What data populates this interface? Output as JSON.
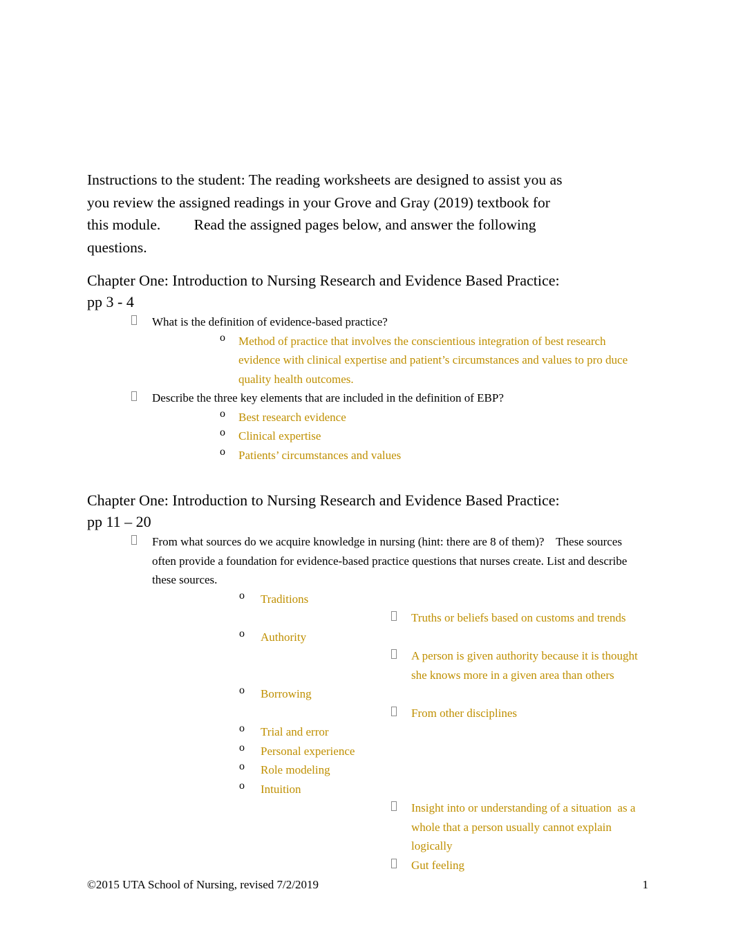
{
  "document": {
    "intro": "Instructions to the student: The reading worksheets are designed to assist you as you review the assigned readings in your Grove and Gray (2019) textbook for this module.         Read the assigned pages below, and answer the following questions.",
    "colors": {
      "answer_text": "#BF8F00",
      "body_text": "#000000",
      "page_background": "#FFFFFF"
    },
    "sections": [
      {
        "heading": "Chapter One: Introduction to Nursing Research and Evidence Based Practice: pp 3 - 4",
        "items": [
          {
            "question": "What is the definition of evidence-based practice?",
            "answers": [
              "Method of practice that involves the conscientious integration of best research evidence with clinical expertise and patient’s circumstances and values to pro duce quality health outcomes."
            ]
          },
          {
            "question": "Describe the three key elements that are included in the definition of EBP?",
            "answers": [
              "Best research evidence",
              "Clinical expertise",
              "Patients’ circumstances and values"
            ]
          }
        ]
      },
      {
        "heading": "Chapter One: Introduction to Nursing Research and Evidence Based Practice: pp 11 – 20",
        "items": [
          {
            "question": "From what sources do we acquire knowledge in nursing (hint: there are 8 of them)?    These sources often provide a foundation for evidence-based practice questions that nurses create. List and describe these sources.",
            "sources": [
              {
                "name": "Traditions",
                "details": [
                  "Truths or beliefs based on customs and trends"
                ]
              },
              {
                "name": "Authority",
                "details": [
                  "A person is given authority because it is thought she knows more in a given area than others"
                ]
              },
              {
                "name": "Borrowing",
                "details": [
                  "From other disciplines"
                ]
              },
              {
                "name": "Trial and error",
                "details": []
              },
              {
                "name": "Personal experience",
                "details": []
              },
              {
                "name": "Role modeling",
                "details": []
              },
              {
                "name": "Intuition",
                "details": [
                  "Insight into or understanding of a situation  as a whole that a person usually cannot explain logically",
                  "Gut feeling"
                ]
              }
            ]
          }
        ]
      }
    ],
    "footer": {
      "copyright": "©2015 UTA School of Nursing, revised 7/2/2019",
      "page_number": "1"
    },
    "markers": {
      "level1_bullet": "missing-glyph-box",
      "level2_bullet": "o",
      "level3_bullet": "missing-glyph-box"
    }
  }
}
